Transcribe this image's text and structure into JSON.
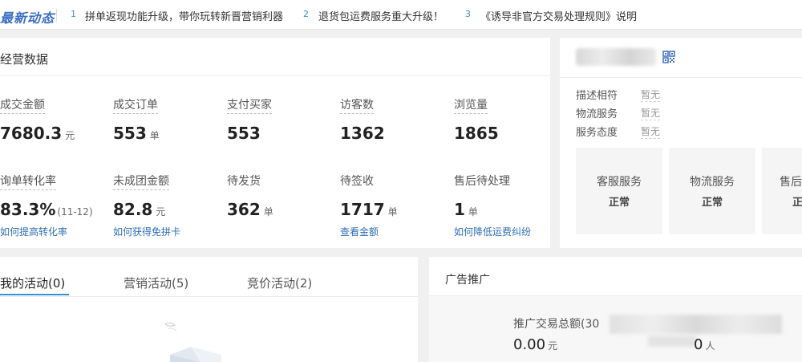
{
  "news": {
    "title": "最新动态",
    "items": [
      {
        "num": "1",
        "text": "拼单返现功能升级，带你玩转新晋营销利器"
      },
      {
        "num": "2",
        "text": "退货包运费服务重大升级！"
      },
      {
        "num": "3",
        "text": "《诱导非官方交易处理规则》说明"
      }
    ]
  },
  "ops": {
    "title": "经营数据",
    "row1": [
      {
        "label": "成交金额",
        "value": "7680.3",
        "unit": "元"
      },
      {
        "label": "成交订单",
        "value": "553",
        "unit": "单"
      },
      {
        "label": "支付买家",
        "value": "553",
        "unit": ""
      },
      {
        "label": "访客数",
        "value": "1362",
        "unit": ""
      },
      {
        "label": "浏览量",
        "value": "1865",
        "unit": ""
      }
    ],
    "row2": [
      {
        "label": "询单转化率",
        "value": "83.3%",
        "unit": "",
        "extra": "(11-12)",
        "link": "如何提高转化率"
      },
      {
        "label": "未成团金额",
        "value": "82.8",
        "unit": "元",
        "link": "如何获得免拼卡"
      },
      {
        "label": "待发货",
        "value": "362",
        "unit": "单"
      },
      {
        "label": "待签收",
        "value": "1717",
        "unit": "单",
        "link": "查看金额"
      },
      {
        "label": "售后待处理",
        "value": "1",
        "unit": "单",
        "link": "如何降低运费纠纷"
      }
    ]
  },
  "shop": {
    "scores": [
      {
        "label": "描述相符",
        "value": "暂无"
      },
      {
        "label": "物流服务",
        "value": "暂无"
      },
      {
        "label": "服务态度",
        "value": "暂无"
      }
    ],
    "services": [
      {
        "label": "客服服务",
        "status": "正常"
      },
      {
        "label": "物流服务",
        "status": "正常"
      },
      {
        "label": "售后",
        "status": "正"
      }
    ]
  },
  "activity": {
    "tabs": [
      "我的活动(0)",
      "营销活动(5)",
      "竞价活动(2)"
    ]
  },
  "ads": {
    "title": "广告推广",
    "metric_label": "推广交易总额(30",
    "metric_value": "0.00",
    "metric_unit": "元",
    "metric2_value": "0",
    "metric2_unit": "人"
  },
  "colors": {
    "accent": "#3a8fd0",
    "link": "#2f6eb5",
    "title": "#3a6fc4"
  }
}
